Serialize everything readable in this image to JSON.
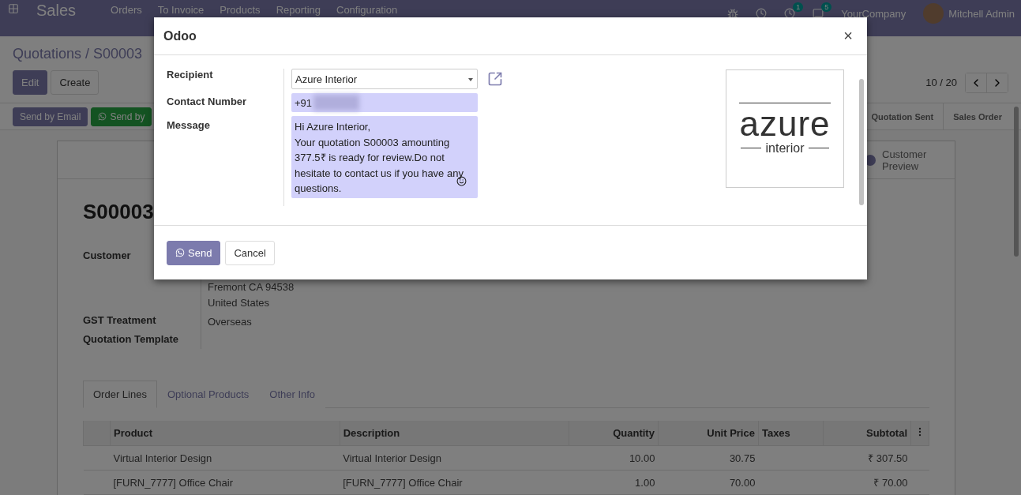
{
  "navbar": {
    "app": "Sales",
    "menu": [
      "Orders",
      "To Invoice",
      "Products",
      "Reporting",
      "Configuration"
    ],
    "activity_count": "1",
    "message_count": "5",
    "company": "YourCompany",
    "user": "Mitchell Admin"
  },
  "breadcrumb": "Quotations / S00003",
  "actions": [
    "Edit",
    "Create"
  ],
  "pager": "10 / 20",
  "header_buttons": [
    {
      "label": "Send by Email",
      "kind": "primary"
    },
    {
      "label": "Send by",
      "kind": "whatsapp"
    }
  ],
  "statusbar": [
    {
      "label": "Quotation Sent",
      "selected": false
    },
    {
      "label": "Sales Order",
      "selected": false
    }
  ],
  "sheet": {
    "preview_button": "Customer Preview",
    "title": "S00003",
    "fields": [
      {
        "label": "Customer"
      },
      {
        "lines": [
          "Fremont CA 94538",
          "United States"
        ]
      },
      {
        "label": "GST Treatment",
        "lines": [
          "Overseas"
        ]
      },
      {
        "label": "Quotation Template"
      }
    ],
    "tabs": [
      {
        "label": "Order Lines",
        "selected": true
      },
      {
        "label": "Optional Products",
        "selected": false
      },
      {
        "label": "Other Info",
        "selected": false
      }
    ],
    "table": {
      "columns": [
        "Product",
        "Description",
        "Quantity",
        "Unit Price",
        "Taxes",
        "Subtotal"
      ],
      "rows": [
        [
          "Virtual Interior Design",
          "Virtual Interior Design",
          "10.00",
          "30.75",
          "",
          "₹ 307.50"
        ],
        [
          "[FURN_7777] Office Chair",
          "[FURN_7777] Office Chair",
          "1.00",
          "70.00",
          "",
          "₹ 70.00"
        ]
      ]
    }
  },
  "dialog": {
    "title": "Odoo",
    "close": "×",
    "recipient_label": "Recipient",
    "recipient": "Azure Interior",
    "contact_label": "Contact Number",
    "contact_prefix": "+91",
    "message_label": "Message",
    "message": [
      "Hi Azure Interior,",
      "Your quotation S00003 amounting 377.5₹ is ready for review.Do not hesitate to contact us if you have any questions."
    ],
    "logo": {
      "name": "azure",
      "tagline": "interior"
    },
    "buttons": [
      {
        "label": "Send",
        "kind": "primary"
      },
      {
        "label": "Cancel",
        "kind": "secondary"
      }
    ]
  }
}
